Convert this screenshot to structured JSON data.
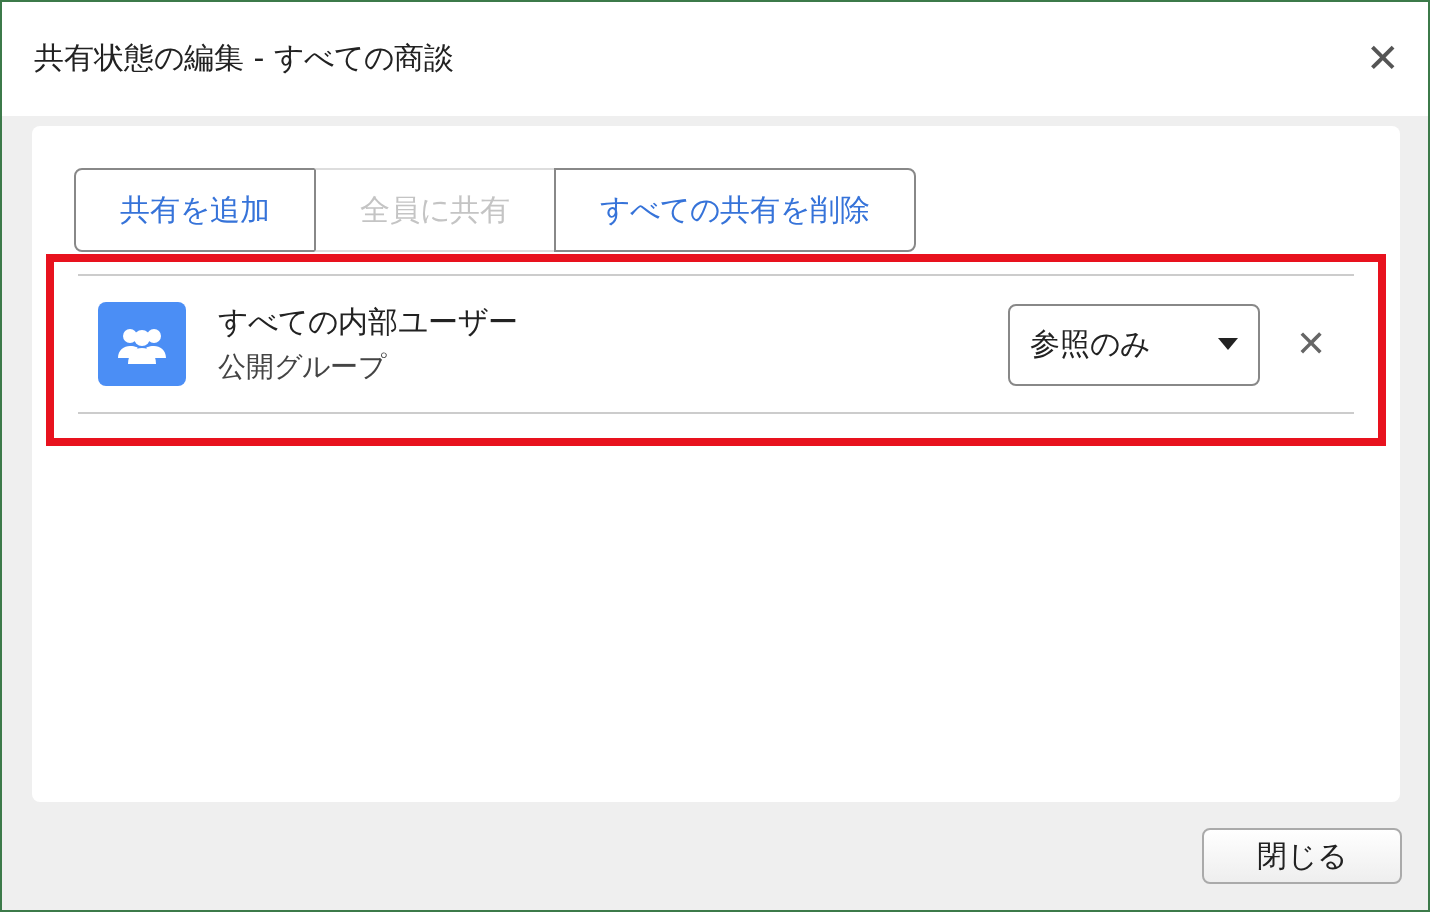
{
  "window": {
    "title": "共有状態の編集 - すべての商談",
    "close_glyph": "✕"
  },
  "actions": [
    {
      "label": "共有を追加",
      "disabled": false
    },
    {
      "label": "全員に共有",
      "disabled": true
    },
    {
      "label": "すべての共有を削除",
      "disabled": false
    }
  ],
  "shares": [
    {
      "name": "すべての内部ユーザー",
      "type": "公開グループ",
      "access": "参照のみ",
      "highlighted": true
    }
  ],
  "footer": {
    "close_button": "閉じる"
  }
}
